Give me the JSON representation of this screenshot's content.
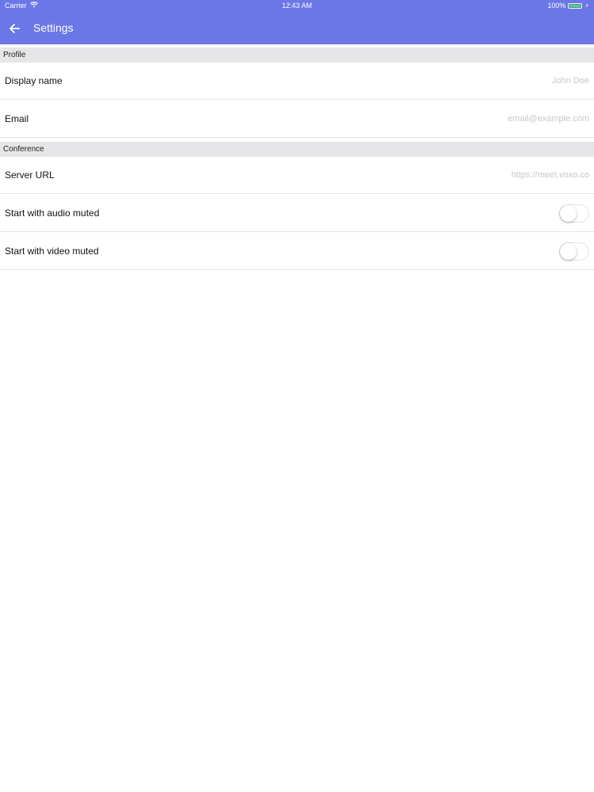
{
  "status_bar": {
    "carrier": "Carrier",
    "time": "12:43 AM",
    "battery": "100%"
  },
  "nav": {
    "title": "Settings",
    "back_icon": "arrow-left-icon"
  },
  "sections": {
    "profile": {
      "header": "Profile",
      "display_name": {
        "label": "Display name",
        "placeholder": "John Doe",
        "value": ""
      },
      "email": {
        "label": "Email",
        "placeholder": "email@example.com",
        "value": ""
      }
    },
    "conference": {
      "header": "Conference",
      "server_url": {
        "label": "Server URL",
        "placeholder": "https://meet.voxo.co",
        "value": ""
      },
      "audio_muted": {
        "label": "Start with audio muted",
        "on": false
      },
      "video_muted": {
        "label": "Start with video muted",
        "on": false
      }
    }
  },
  "colors": {
    "accent": "#6b77e6",
    "section_bg": "#e6e6e8",
    "placeholder": "#c8c8cc",
    "battery": "#4cd964"
  }
}
